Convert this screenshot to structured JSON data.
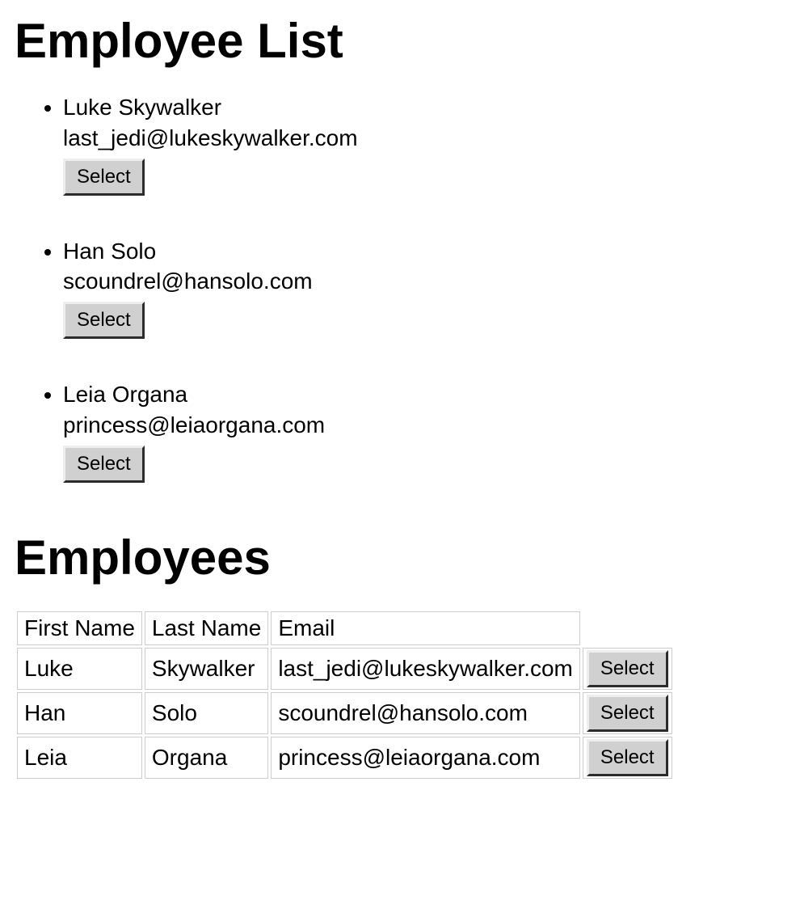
{
  "headings": {
    "list_title": "Employee List",
    "table_title": "Employees"
  },
  "buttons": {
    "select_label": "Select"
  },
  "table": {
    "headers": {
      "first_name": "First Name",
      "last_name": "Last Name",
      "email": "Email"
    }
  },
  "employees": [
    {
      "first_name": "Luke",
      "last_name": "Skywalker",
      "full_name": "Luke Skywalker",
      "email": "last_jedi@lukeskywalker.com"
    },
    {
      "first_name": "Han",
      "last_name": "Solo",
      "full_name": "Han Solo",
      "email": "scoundrel@hansolo.com"
    },
    {
      "first_name": "Leia",
      "last_name": "Organa",
      "full_name": "Leia Organa",
      "email": "princess@leiaorgana.com"
    }
  ]
}
